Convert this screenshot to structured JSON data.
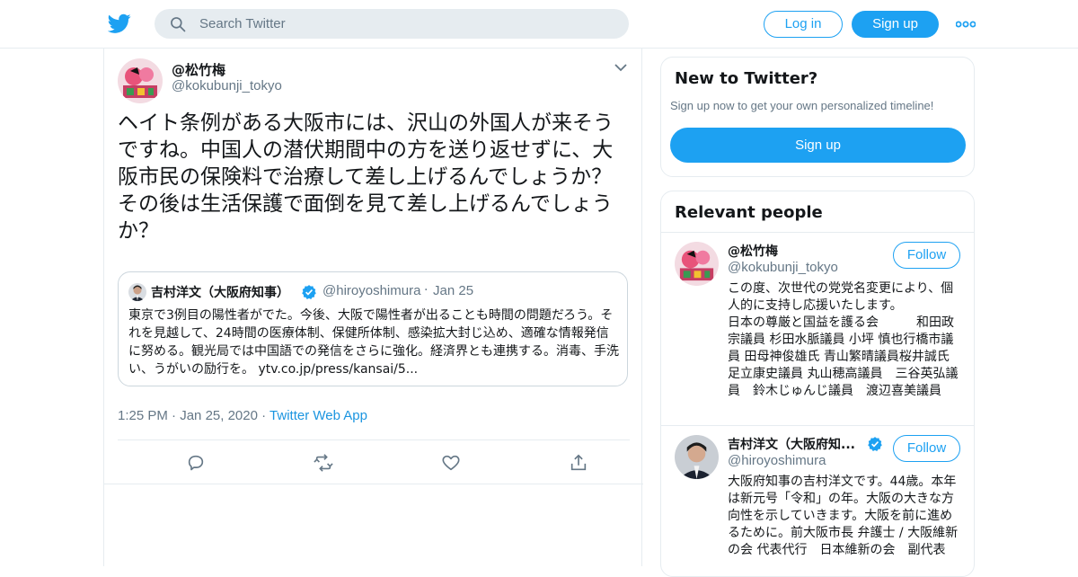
{
  "header": {
    "logo_icon": "twitter-bird-icon",
    "search_placeholder": "Search Twitter",
    "login_label": "Log in",
    "signup_label": "Sign up",
    "more_icon": "more-dots-icon",
    "accent_color": "#1da1f2"
  },
  "tweet": {
    "author_name": "@松竹梅",
    "author_handle": "@kokubunji_tokyo",
    "text": "ヘイト条例がある大阪市には、沢山の外国人が来そうですね。中国人の潜伏期間中の方を送り返せずに、大阪市民の保険料で治療して差し上げるんでしょうか？その後は生活保護で面倒を見て差し上げるんでしょうか？",
    "quote": {
      "name": "吉村洋文（大阪府知事）",
      "handle": "@hiroyoshimura",
      "separator": "·",
      "date": "Jan 25",
      "text": "東京で3例目の陽性者がでた。今後、大阪で陽性者が出ることも時間の問題だろう。それを見越して、24時間の医療体制、保健所体制、感染拡大封じ込め、適確な情報発信に努める。観光局では中国語での発信をさらに強化。経済界とも連携する。消毒、手洗い、うがいの励行を。 ytv.co.jp/press/kansai/5..."
    },
    "time": "1:25 PM",
    "separator": "·",
    "date": "Jan 25, 2020",
    "source": "Twitter Web App"
  },
  "sidebar": {
    "new_to_twitter": {
      "title": "New to Twitter?",
      "subtitle": "Sign up now to get your own personalized timeline!",
      "button_label": "Sign up"
    },
    "relevant_people": {
      "title": "Relevant people",
      "people": [
        {
          "name": "@松竹梅",
          "handle": "@kokubunji_tokyo",
          "follow_label": "Follow",
          "bio": "この度、次世代の党党名変更により、個人的に支持し応援いたします。\n日本の尊厳と国益を護る会　　　和田政宗議員 杉田水脈議員 小坪 慎也行橋市議員 田母神俊雄氏 青山繁晴議員桜井誠氏 足立康史議員 丸山穂高議員　三谷英弘議員　鈴木じゅんじ議員　渡辺喜美議員"
        },
        {
          "name": "吉村洋文（大阪府知...",
          "handle": "@hiroyoshimura",
          "follow_label": "Follow",
          "bio": "大阪府知事の吉村洋文です。44歳。本年は新元号「令和」の年。大阪の大きな方向性を示していきます。大阪を前に進めるために。前大阪市長 弁護士 / 大阪維新の会 代表代行　日本維新の会　副代表"
        }
      ]
    }
  }
}
